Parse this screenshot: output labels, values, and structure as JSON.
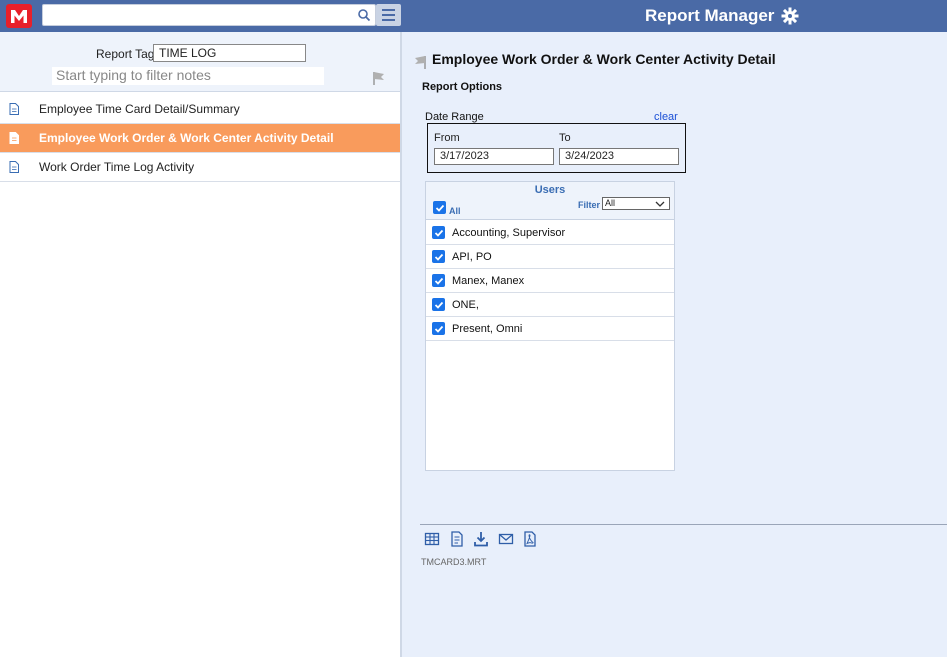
{
  "header": {
    "title": "Report Manager",
    "search_value": "",
    "logo_text": "M"
  },
  "sidebar": {
    "report_tag_label": "Report Tag",
    "report_tag_value": "TIME LOG",
    "filter_placeholder": "Start typing to filter notes",
    "reports": [
      {
        "label": "Employee Time Card Detail/Summary",
        "selected": false
      },
      {
        "label": "Employee Work Order & Work Center Activity Detail",
        "selected": true
      },
      {
        "label": "Work Order Time Log Activity",
        "selected": false
      }
    ]
  },
  "main": {
    "report_title": "Employee Work Order & Work Center Activity Detail",
    "options_label": "Report Options",
    "date_range": {
      "label": "Date Range",
      "clear_label": "clear",
      "from_label": "From",
      "to_label": "To",
      "from_value": "3/17/2023",
      "to_value": "3/24/2023"
    },
    "users": {
      "title": "Users",
      "all_label": "All",
      "all_checked": true,
      "filter_label": "Filter",
      "filter_value": "All",
      "items": [
        {
          "label": "Accounting, Supervisor",
          "checked": true
        },
        {
          "label": "API, PO",
          "checked": true
        },
        {
          "label": "Manex, Manex",
          "checked": true
        },
        {
          "label": "ONE,",
          "checked": true
        },
        {
          "label": "Present, Omni",
          "checked": true
        }
      ]
    },
    "toolbar": [
      "grid-icon",
      "report-icon",
      "download-icon",
      "email-icon",
      "pdf-icon"
    ],
    "file_name": "TMCARD3.MRT"
  },
  "colors": {
    "topbar": "#4a6aa6",
    "selected_row": "#f99b5c",
    "accent": "#1a73e8",
    "link": "#1a4fd6"
  }
}
